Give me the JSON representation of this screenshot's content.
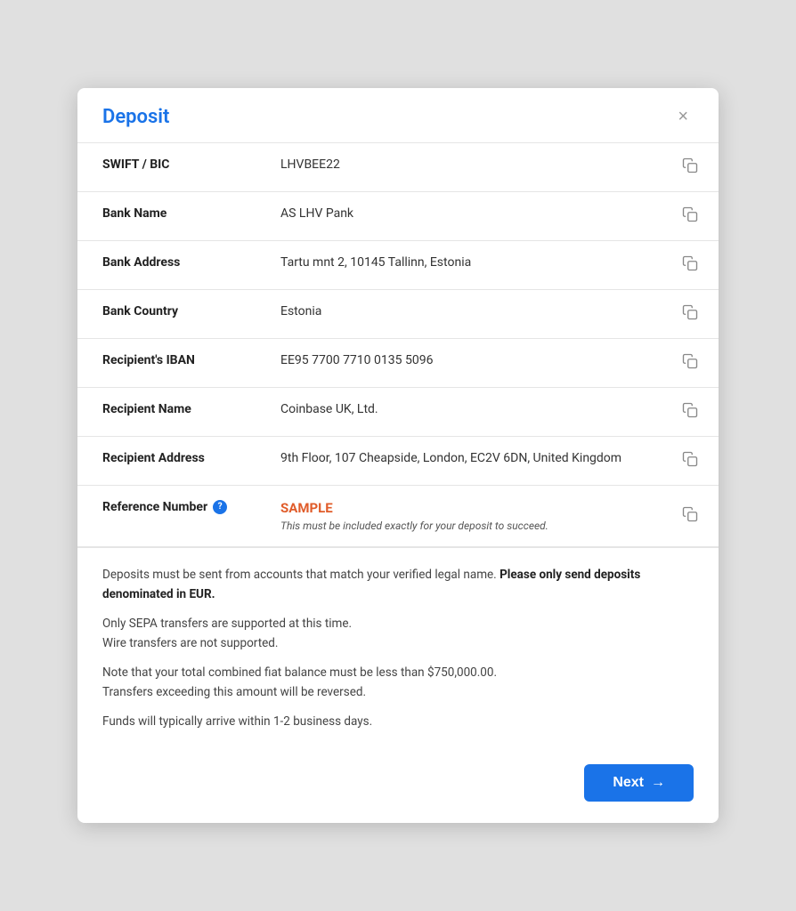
{
  "modal": {
    "title": "Deposit",
    "close_label": "×"
  },
  "fields": [
    {
      "label": "SWIFT / BIC",
      "value": "LHVBEE22",
      "has_copy": true,
      "id": "swift-bic"
    },
    {
      "label": "Bank Name",
      "value": "AS LHV Pank",
      "has_copy": true,
      "id": "bank-name"
    },
    {
      "label": "Bank Address",
      "value": "Tartu mnt 2, 10145 Tallinn, Estonia",
      "has_copy": true,
      "id": "bank-address"
    },
    {
      "label": "Bank Country",
      "value": "Estonia",
      "has_copy": true,
      "id": "bank-country"
    },
    {
      "label": "Recipient's IBAN",
      "value": "EE95 7700 7710 0135 5096",
      "has_copy": true,
      "id": "recipient-iban"
    },
    {
      "label": "Recipient Name",
      "value": "Coinbase UK, Ltd.",
      "has_copy": true,
      "id": "recipient-name"
    },
    {
      "label": "Recipient Address",
      "value": "9th Floor, 107 Cheapside, London, EC2V 6DN, United Kingdom",
      "has_copy": true,
      "id": "recipient-address"
    }
  ],
  "reference": {
    "label": "Reference Number",
    "value": "SAMPLE",
    "note": "This must be included exactly for your deposit to succeed.",
    "has_help": true,
    "has_copy": true
  },
  "disclaimer": {
    "line1_normal": "Deposits must be sent from accounts that match your verified legal name.",
    "line1_bold": " Please only send deposits denominated in EUR.",
    "line2": "Only SEPA transfers are supported at this time.\nWire transfers are not supported.",
    "line3": "Note that your total combined fiat balance must be less than $750,000.00.\nTransfers exceeding this amount will be reversed.",
    "line4": "Funds will typically arrive within 1-2 business days."
  },
  "actions": {
    "next_label": "Next",
    "next_arrow": "→"
  }
}
